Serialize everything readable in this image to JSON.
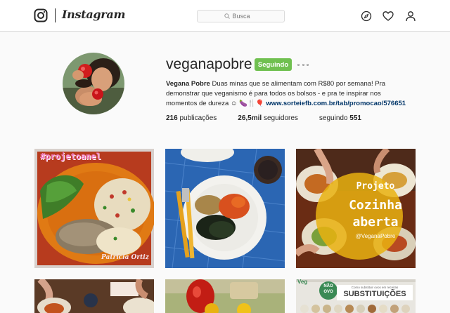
{
  "header": {
    "wordmark": "Instagram",
    "search_placeholder": "Busca",
    "icons": [
      "camera-icon",
      "compass-icon",
      "heart-icon",
      "user-icon"
    ]
  },
  "profile": {
    "username": "veganapobre",
    "follow_label": "Seguindo",
    "bio_name": "Vegana Pobre",
    "bio_text": "Duas minas que se alimentam com R$80 por semana! Pra demonstrar que veganismo é para todos os bolsos - e pra te inspirar nos momentos de dureza ☺ 🍆🍴🎈 ",
    "bio_link": "www.sorteiefb.com.br/tab/promocao/576651",
    "posts_count": "216",
    "posts_label": "publicações",
    "followers_count": "26,5mil",
    "followers_label": "seguidores",
    "following_label": "seguindo",
    "following_count": "551"
  },
  "posts": [
    {
      "overlay_text": "#projetoanel",
      "signature": "Patrícia Ortiz"
    },
    {
      "overlay_text": ""
    },
    {
      "overlay_line1": "Projeto",
      "overlay_line2": "Cozinha",
      "overlay_line3": "aberta",
      "overlay_handle": "@VeganaPobre"
    },
    {
      "overlay_text": ""
    },
    {
      "overlay_text": ""
    },
    {
      "badge_top": "Veg",
      "badge_small": "NÃO",
      "badge_small2": "OVO",
      "banner_small": "Como substituir ovos em receitas",
      "banner_big": "SUBSTITUIÇÕES"
    }
  ],
  "colors": {
    "follow_green": "#70c050",
    "link_blue": "#003569",
    "page_bg": "#fafafa"
  }
}
